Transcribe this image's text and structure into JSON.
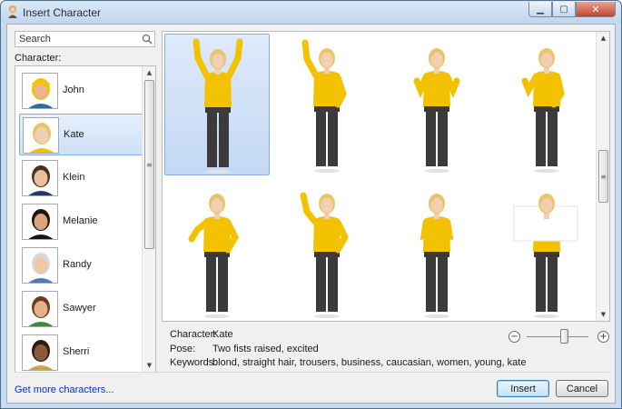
{
  "window": {
    "title": "Insert Character"
  },
  "search": {
    "placeholder": "Search"
  },
  "character_list": {
    "label": "Character:",
    "items": [
      {
        "name": "John",
        "selected": false
      },
      {
        "name": "Kate",
        "selected": true
      },
      {
        "name": "Klein",
        "selected": false
      },
      {
        "name": "Melanie",
        "selected": false
      },
      {
        "name": "Randy",
        "selected": false
      },
      {
        "name": "Sawyer",
        "selected": false
      },
      {
        "name": "Sherri",
        "selected": false
      }
    ]
  },
  "poses": [
    {
      "description": "Two fists raised, excited",
      "selected": true,
      "icon": "pose-arms-raised-icon"
    },
    {
      "description": "",
      "selected": false,
      "icon": "pose-one-fist-raised-icon"
    },
    {
      "description": "",
      "selected": false,
      "icon": "pose-two-thumbs-up-icon"
    },
    {
      "description": "",
      "selected": false,
      "icon": "pose-one-thumb-up-icon"
    },
    {
      "description": "",
      "selected": false,
      "icon": "pose-thumb-down-icon"
    },
    {
      "description": "",
      "selected": false,
      "icon": "pose-pointing-up-icon"
    },
    {
      "description": "",
      "selected": false,
      "icon": "pose-clapping-icon"
    },
    {
      "description": "",
      "selected": false,
      "icon": "pose-holding-sign-icon"
    }
  ],
  "details": {
    "character_label": "Character:",
    "character_value": "Kate",
    "pose_label": "Pose:",
    "pose_value": "Two fists raised, excited",
    "keywords_label": "Keywords:",
    "keywords_value": "blond, straight hair, trousers, business, caucasian, women, young, kate"
  },
  "zoom": {
    "out_symbol": "−",
    "in_symbol": "+",
    "level": 0.6
  },
  "footer": {
    "more_link": "Get more characters...",
    "insert_label": "Insert",
    "cancel_label": "Cancel"
  },
  "colors": {
    "selection_fill": "#cce0f6",
    "shirt": "#f2c200",
    "trousers": "#3b3b3b",
    "link": "#0033cc"
  }
}
